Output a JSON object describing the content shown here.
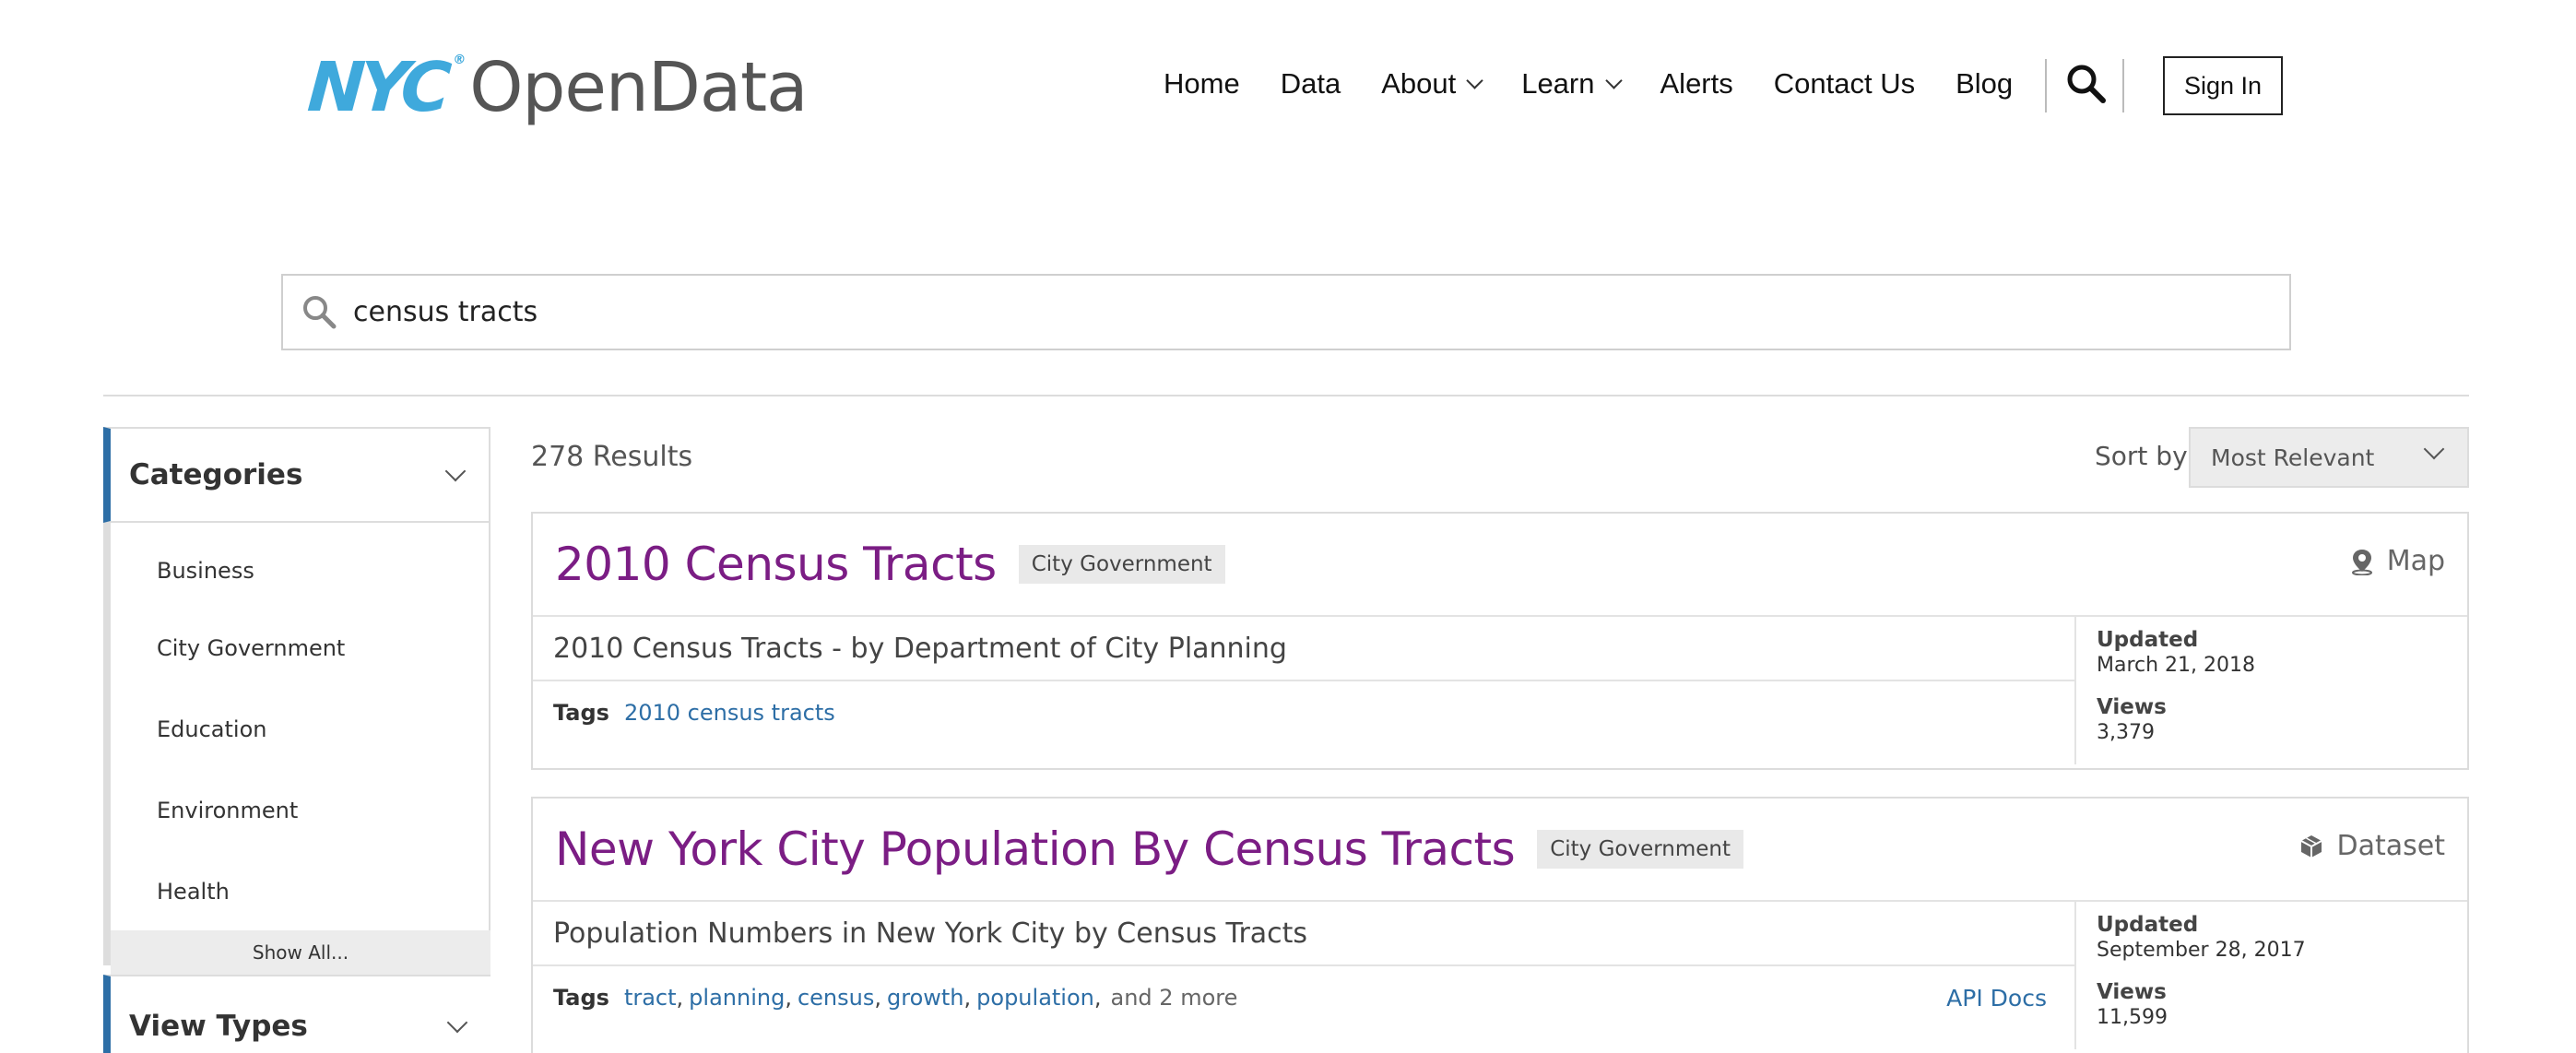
{
  "header": {
    "logo_nyc": "NYC",
    "logo_tm": "®",
    "logo_opendata": "OpenData",
    "nav": [
      {
        "label": "Home"
      },
      {
        "label": "Data"
      },
      {
        "label": "About",
        "dropdown": true
      },
      {
        "label": "Learn",
        "dropdown": true
      },
      {
        "label": "Alerts"
      },
      {
        "label": "Contact Us"
      },
      {
        "label": "Blog"
      }
    ],
    "sign_in": "Sign In",
    "search_icon": "search-icon"
  },
  "search": {
    "value": "census tracts",
    "icon": "search-icon"
  },
  "sidebar": {
    "categories_title": "Categories",
    "categories": [
      "Business",
      "City Government",
      "Education",
      "Environment",
      "Health"
    ],
    "show_all": "Show All...",
    "view_types_title": "View Types"
  },
  "results": {
    "count": "278 Results",
    "sort_label": "Sort by",
    "sort_value": "Most Relevant",
    "items": [
      {
        "title": "2010 Census Tracts",
        "category": "City Government",
        "view_type": "Map",
        "view_icon": "map-pin-icon",
        "description": "2010 Census Tracts - by Department of City Planning",
        "tags_label": "Tags",
        "tags": [
          "2010 census tracts"
        ],
        "more": "",
        "api_docs": "",
        "updated_label": "Updated",
        "updated": "March 21, 2018",
        "views_label": "Views",
        "views": "3,379"
      },
      {
        "title": "New York City Population By Census Tracts",
        "category": "City Government",
        "view_type": "Dataset",
        "view_icon": "dataset-cube-icon",
        "description": "Population Numbers in New York City by Census Tracts",
        "tags_label": "Tags",
        "tags": [
          "tract",
          "planning",
          "census",
          "growth",
          "population"
        ],
        "more": "and 2 more",
        "api_docs": "API Docs",
        "updated_label": "Updated",
        "updated": "September 28, 2017",
        "views_label": "Views",
        "views": "11,599"
      }
    ]
  },
  "colors": {
    "title_purple": "#7b1d84",
    "link_blue": "#2d6ea6",
    "logo_blue": "#3fa9dc"
  }
}
